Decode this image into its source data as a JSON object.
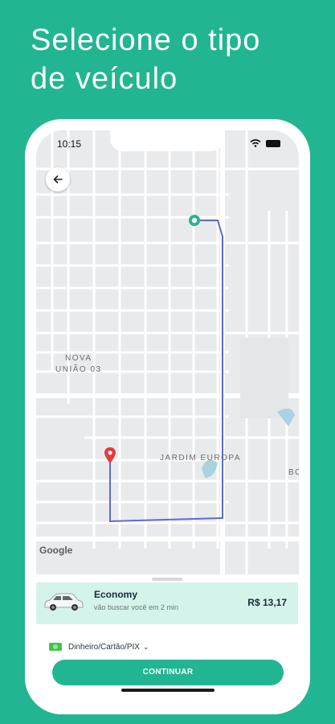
{
  "headline": {
    "line1": "Selecione o tipo",
    "line2": "de veículo"
  },
  "status_bar": {
    "time": "10:15"
  },
  "map": {
    "labels": {
      "nova_uniao_1": "NOVA",
      "nova_uniao_2": "UNIÃO 03",
      "jardim_europa": "JARDIM EUROPA",
      "bo": "BO"
    },
    "attribution": "Google",
    "route_color": "#5b6ad6",
    "origin_color": "#22b592",
    "destination_color": "#e5393f"
  },
  "ride_option": {
    "name": "Economy",
    "eta": "vão buscar você em 2 min",
    "price": "R$ 13,17"
  },
  "payment": {
    "method": "Dinheiro/Cartão/PIX"
  },
  "cta": {
    "label": "CONTINUAR"
  },
  "colors": {
    "brand": "#22b592",
    "selected_option_bg": "#d4f3ea"
  },
  "icons": [
    "back-arrow-icon",
    "location-pin-icon",
    "origin-marker-icon",
    "car-icon",
    "cash-icon",
    "chevron-down-icon",
    "wifi-icon",
    "battery-icon"
  ]
}
